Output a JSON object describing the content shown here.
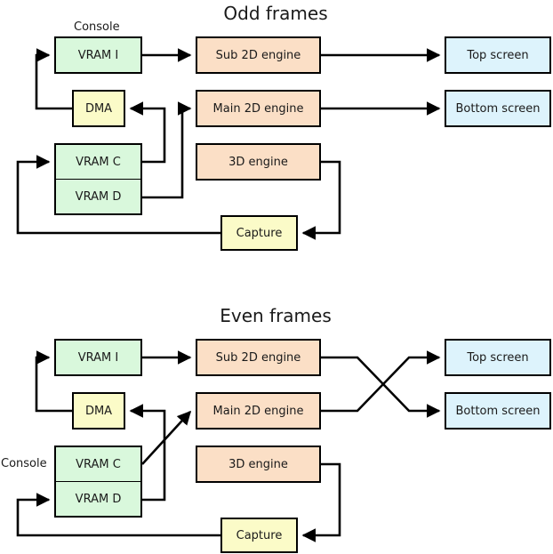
{
  "diagram": {
    "colors": {
      "vram": "#d9f8dc",
      "engine": "#fbdfc6",
      "buffer": "#fbfbc8",
      "screen": "#ddf3fc",
      "stroke": "#000000",
      "background": "#ffffff"
    },
    "sections": [
      {
        "id": "odd",
        "title": "Odd frames",
        "console_label": "Console",
        "nodes": [
          {
            "id": "vram_i",
            "label": "VRAM I",
            "kind": "vram"
          },
          {
            "id": "dma",
            "label": "DMA",
            "kind": "buffer"
          },
          {
            "id": "vram_c",
            "label": "VRAM C",
            "kind": "vram"
          },
          {
            "id": "vram_d",
            "label": "VRAM D",
            "kind": "vram"
          },
          {
            "id": "sub2d",
            "label": "Sub 2D engine",
            "kind": "engine"
          },
          {
            "id": "main2d",
            "label": "Main 2D engine",
            "kind": "engine"
          },
          {
            "id": "engine3d",
            "label": "3D engine",
            "kind": "engine"
          },
          {
            "id": "capture",
            "label": "Capture",
            "kind": "buffer"
          },
          {
            "id": "top",
            "label": "Top screen",
            "kind": "screen"
          },
          {
            "id": "bottom",
            "label": "Bottom screen",
            "kind": "screen"
          }
        ],
        "edges": [
          {
            "from": "vram_i",
            "to": "sub2d"
          },
          {
            "from": "sub2d",
            "to": "top"
          },
          {
            "from": "main2d",
            "to": "bottom"
          },
          {
            "from": "dma",
            "to": "vram_i"
          },
          {
            "from": "vram_c",
            "to": "dma"
          },
          {
            "from": "vram_d",
            "to": "main2d"
          },
          {
            "from": "engine3d",
            "to": "capture"
          },
          {
            "from": "capture",
            "to": "vram_c"
          }
        ]
      },
      {
        "id": "even",
        "title": "Even frames",
        "console_label": "Console",
        "nodes": [
          {
            "id": "vram_i",
            "label": "VRAM I",
            "kind": "vram"
          },
          {
            "id": "dma",
            "label": "DMA",
            "kind": "buffer"
          },
          {
            "id": "vram_c",
            "label": "VRAM C",
            "kind": "vram"
          },
          {
            "id": "vram_d",
            "label": "VRAM D",
            "kind": "vram"
          },
          {
            "id": "sub2d",
            "label": "Sub 2D engine",
            "kind": "engine"
          },
          {
            "id": "main2d",
            "label": "Main 2D engine",
            "kind": "engine"
          },
          {
            "id": "engine3d",
            "label": "3D engine",
            "kind": "engine"
          },
          {
            "id": "capture",
            "label": "Capture",
            "kind": "buffer"
          },
          {
            "id": "top",
            "label": "Top screen",
            "kind": "screen"
          },
          {
            "id": "bottom",
            "label": "Bottom screen",
            "kind": "screen"
          }
        ],
        "edges": [
          {
            "from": "vram_i",
            "to": "sub2d"
          },
          {
            "from": "sub2d",
            "to": "bottom"
          },
          {
            "from": "main2d",
            "to": "top"
          },
          {
            "from": "dma",
            "to": "vram_i"
          },
          {
            "from": "vram_d",
            "to": "dma"
          },
          {
            "from": "vram_c",
            "to": "main2d"
          },
          {
            "from": "engine3d",
            "to": "capture"
          },
          {
            "from": "capture",
            "to": "vram_d"
          }
        ]
      }
    ]
  }
}
